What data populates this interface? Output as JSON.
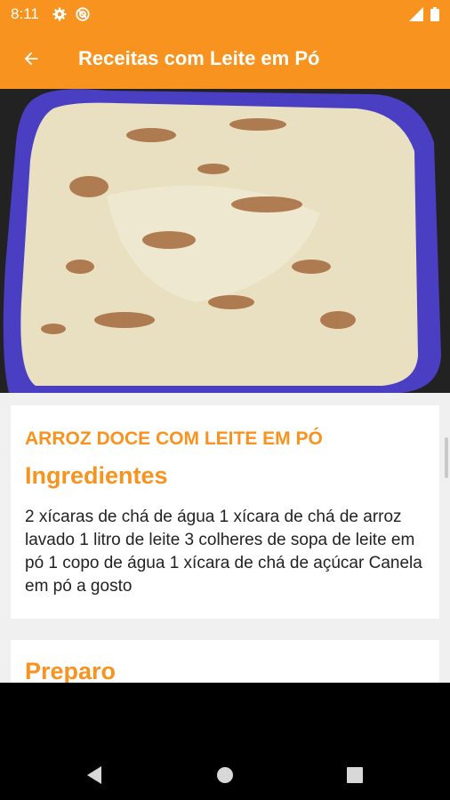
{
  "status_bar": {
    "time": "8:11"
  },
  "app_bar": {
    "title": "Receitas com Leite em Pó"
  },
  "recipe": {
    "title": "ARROZ DOCE COM LEITE EM PÓ",
    "ingredients_heading": "Ingredientes",
    "ingredients_text": " 2 xícaras de chá de água 1 xícara de chá de arroz lavado 1 litro de leite 3 colheres de sopa de leite em pó 1 copo de água 1 xícara de chá de açúcar Canela em pó a gosto",
    "preparation_heading": "Preparo"
  },
  "colors": {
    "accent": "#f7931e",
    "card": "#ffffff",
    "background": "#f0f0f0",
    "bowl": "#4a3ec2"
  },
  "icons": [
    "settings-icon",
    "sync-icon",
    "signal-icon",
    "battery-icon",
    "back-arrow-icon",
    "nav-back-icon",
    "nav-home-icon",
    "nav-recents-icon"
  ]
}
